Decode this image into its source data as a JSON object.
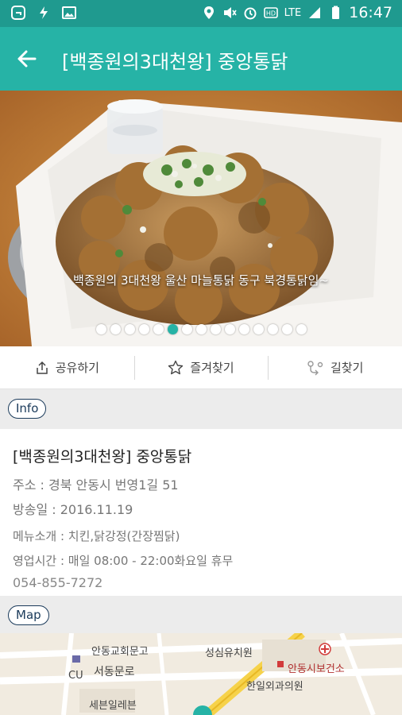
{
  "status_bar": {
    "time": "16:47",
    "network": "LTE"
  },
  "app_bar": {
    "title": "[백종원의3대천왕] 중앙통닭"
  },
  "hero": {
    "caption": "백종원의 3대천왕 울산 마늘통닭 동구 북경통닭임~",
    "dot_count": 15,
    "active_dot": 5
  },
  "actions": [
    {
      "label": "공유하기",
      "icon": "share-icon"
    },
    {
      "label": "즐겨찾기",
      "icon": "star-icon"
    },
    {
      "label": "길찾기",
      "icon": "directions-icon"
    }
  ],
  "info_section": {
    "label": "Info",
    "title": "[백종원의3대천왕] 중앙통닭",
    "address": "주소 : 경북 안동시 번영1길 51",
    "air_date": "방송일 : 2016.11.19",
    "menu": "메뉴소개 : 치킨,닭강정(간장찜닭)",
    "hours": "영업시간 : 매일 08:00 - 22:00화요일 휴무",
    "phone": "054-855-7272"
  },
  "map_section": {
    "label": "Map",
    "places": [
      "안동교회문고",
      "성심유치원",
      "서동문로",
      "CU",
      "안동시보건소",
      "한일외과의원",
      "세븐일레븐"
    ]
  },
  "colors": {
    "accent": "#26b3a6",
    "status_bar": "#1f9a8f"
  }
}
